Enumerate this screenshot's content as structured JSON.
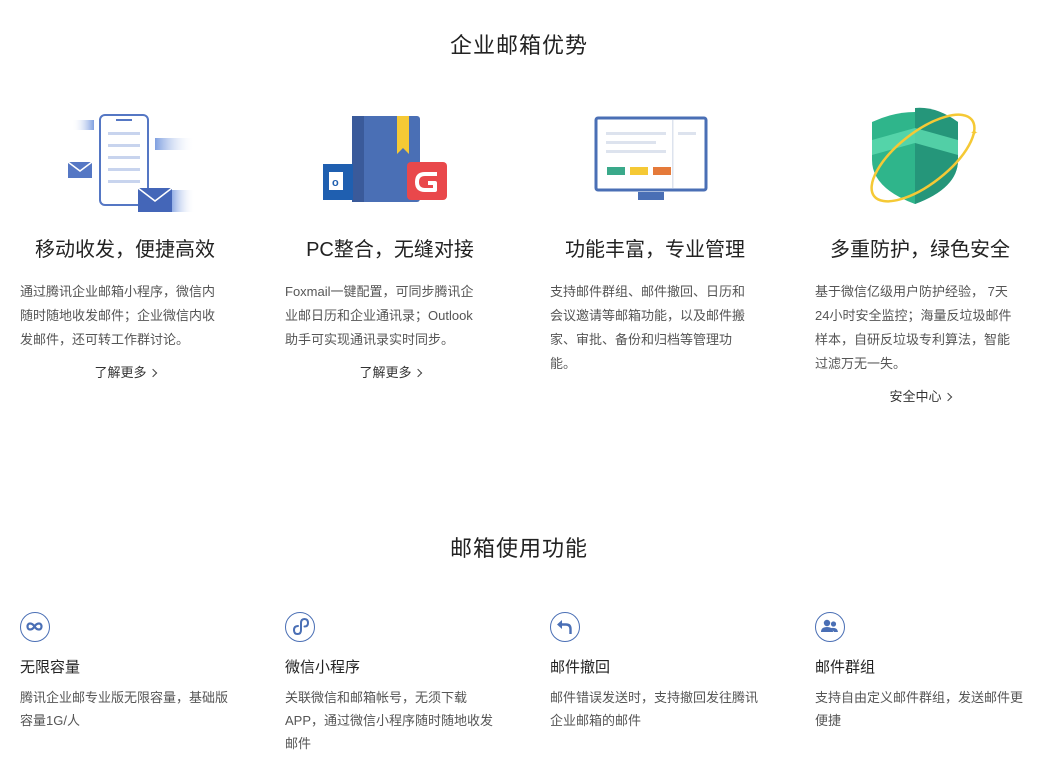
{
  "advantages": {
    "title": "企业邮箱优势",
    "items": [
      {
        "heading": "移动收发，便捷高效",
        "description": "通过腾讯企业邮箱小程序，微信内随时随地收发邮件；企业微信内收发邮件，还可转工作群讨论。",
        "link": "了解更多",
        "icon": "mobile-mail-icon"
      },
      {
        "heading": "PC整合，无缝对接",
        "description": "Foxmail一键配置，可同步腾讯企业邮日历和企业通讯录；Outlook助手可实现通讯录实时同步。",
        "link": "了解更多",
        "icon": "pc-integration-icon"
      },
      {
        "heading": "功能丰富，专业管理",
        "description": "支持邮件群组、邮件撤回、日历和会议邀请等邮箱功能，以及邮件搬家、审批、备份和归档等管理功能。",
        "icon": "monitor-icon"
      },
      {
        "heading": "多重防护，绿色安全",
        "description": "基于微信亿级用户防护经验， 7天24小时安全监控；海量反垃圾邮件样本，自研反垃圾专利算法，智能过滤万无一失。",
        "link": "安全中心",
        "icon": "shield-icon"
      }
    ]
  },
  "features": {
    "title": "邮箱使用功能",
    "items": [
      {
        "name": "无限容量",
        "description": "腾讯企业邮专业版无限容量，基础版容量1G/人",
        "icon": "infinity-icon"
      },
      {
        "name": "微信小程序",
        "description": "关联微信和邮箱帐号，无须下载APP，通过微信小程序随时随地收发邮件",
        "icon": "mini-program-icon"
      },
      {
        "name": "邮件撤回",
        "description": "邮件错误发送时，支持撤回发往腾讯企业邮箱的邮件",
        "icon": "recall-icon"
      },
      {
        "name": "邮件群组",
        "description": "支持自由定义邮件群组，发送邮件更便捷",
        "icon": "group-icon"
      }
    ]
  },
  "colors": {
    "accent_blue": "#4a6fb5",
    "shield_green": "#2fb58b",
    "ring_yellow": "#f5c935",
    "foxmail_red": "#e9484b",
    "outlook_blue": "#1f5fb0"
  }
}
